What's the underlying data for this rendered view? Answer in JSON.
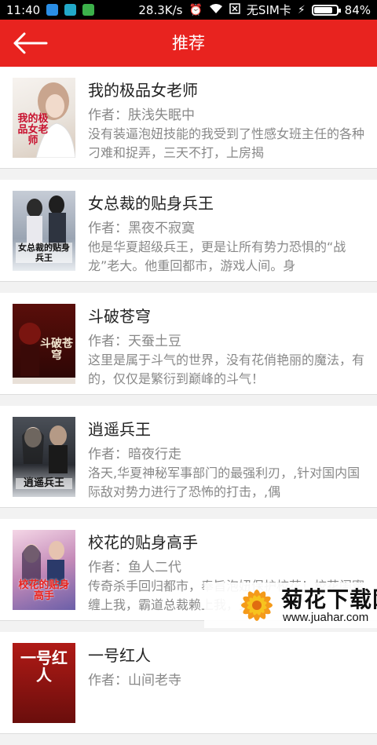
{
  "status_bar": {
    "time": "11:40",
    "speed": "28.3K/s",
    "sim": "无SIM卡",
    "battery": "84%",
    "battery_level": 0.84
  },
  "header": {
    "title": "推荐",
    "accent_color": "#e8231f"
  },
  "books": [
    {
      "title": "我的极品女老师",
      "author": "作者：肤浅失眠中",
      "description": "没有装逼泡妞技能的我受到了性感女班主任的各种刁难和捉弄，三天不打，上房揭",
      "cover_text": "我的极品女老师"
    },
    {
      "title": "女总裁的贴身兵王",
      "author": "作者：黑夜不寂寞",
      "description": "他是华夏超级兵王，更是让所有势力恐惧的“战龙”老大。他重回都市，游戏人间。身",
      "cover_text": "女总裁的贴身兵王"
    },
    {
      "title": "斗破苍穹",
      "author": "作者：天蚕土豆",
      "description": "这里是属于斗气的世界，没有花俏艳丽的魔法，有的，仅仅是繁衍到巅峰的斗气！",
      "cover_text": "斗破苍穹"
    },
    {
      "title": "逍遥兵王",
      "author": "作者：暗夜行走",
      "description": "洛天,华夏神秘军事部门的最强利刃，,针对国内国际敌对势力进行了恐怖的打击，,偶",
      "cover_text": "逍遥兵王"
    },
    {
      "title": "校花的贴身高手",
      "author": "作者：鱼人二代",
      "description": "传奇杀手回归都市，奉旨泡妞保护校花！校花闺蜜缠上我，霸道总裁赖上我，火辣",
      "cover_text": "校花的贴身高手"
    },
    {
      "title": "一号红人",
      "author": "作者：山间老寺",
      "description": "",
      "cover_text": "一号红人"
    }
  ],
  "watermark": {
    "name": "菊花下载网",
    "url": "www.juahar.com"
  }
}
